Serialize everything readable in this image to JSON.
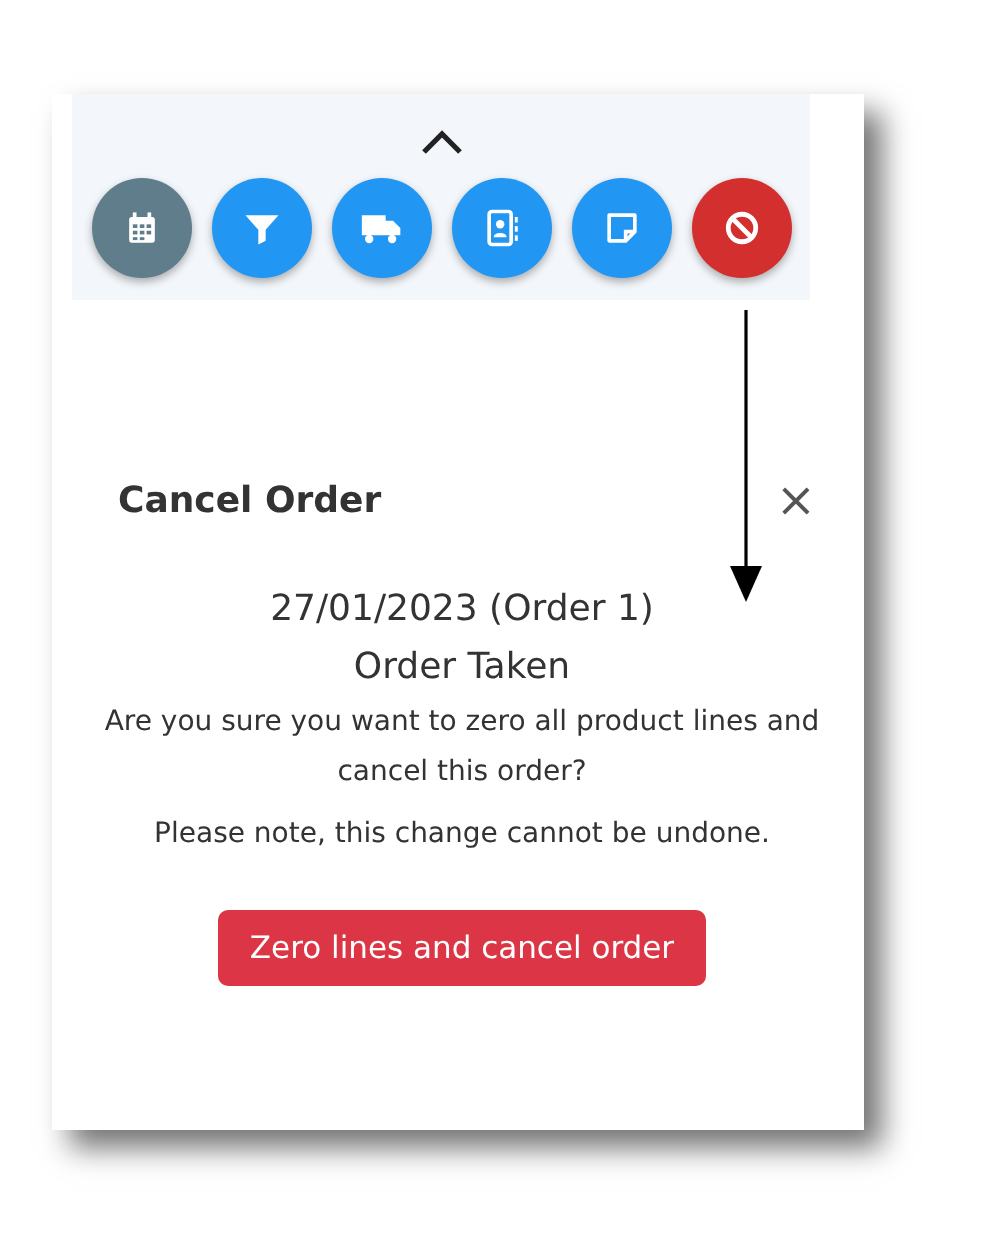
{
  "toolbar": {
    "buttons": [
      {
        "kind": "calendar",
        "color": "#607d8b"
      },
      {
        "kind": "filter",
        "color": "#2196f3"
      },
      {
        "kind": "truck",
        "color": "#2196f3"
      },
      {
        "kind": "contacts",
        "color": "#2196f3"
      },
      {
        "kind": "note",
        "color": "#2196f3"
      },
      {
        "kind": "cancel",
        "color": "#d32f2f"
      }
    ]
  },
  "dialog": {
    "title": "Cancel Order",
    "close": "×",
    "date": "27/01/2023 (Order 1)",
    "status": "Order Taken",
    "question": "Are you sure you want to zero all product lines and cancel this order?",
    "note": "Please note, this change cannot be undone.",
    "button": "Zero lines and cancel order"
  }
}
